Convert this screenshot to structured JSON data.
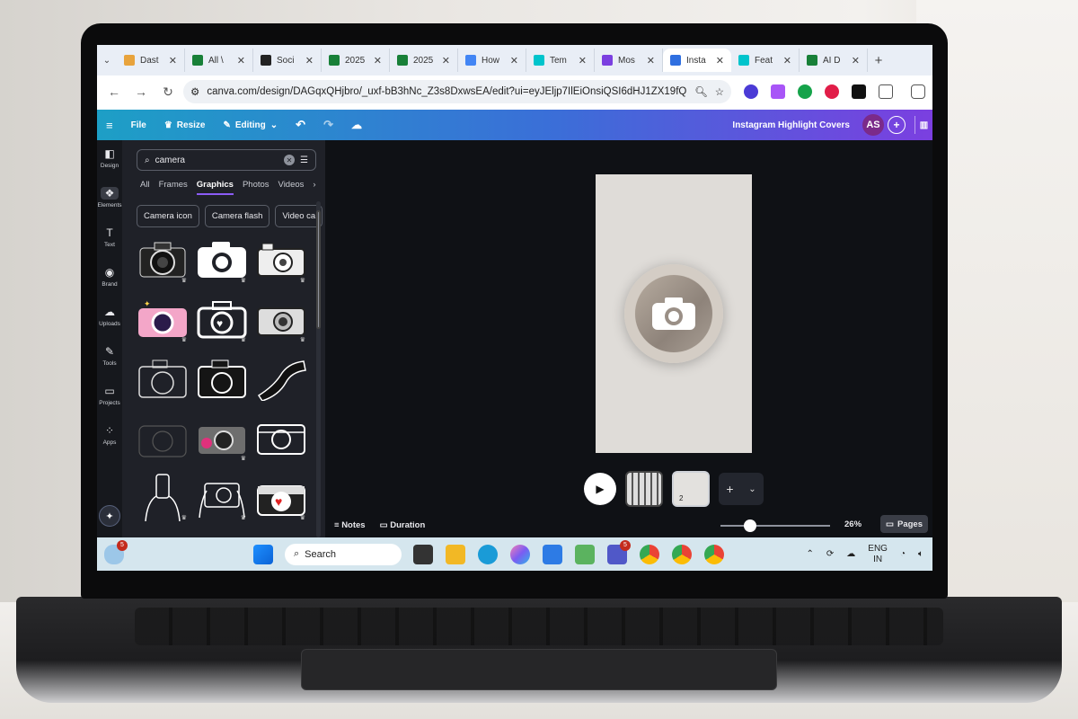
{
  "browser": {
    "tabs": [
      {
        "label": "Dast",
        "color": "#e8a33c"
      },
      {
        "label": "All \\",
        "color": "#188038"
      },
      {
        "label": "Soci",
        "color": "#222222"
      },
      {
        "label": "2025",
        "color": "#188038"
      },
      {
        "label": "2025",
        "color": "#188038"
      },
      {
        "label": "How",
        "color": "#4285f4"
      },
      {
        "label": "Tem",
        "color": "#00c4cc"
      },
      {
        "label": "Mos",
        "color": "#7b3fe0"
      },
      {
        "label": "Insta",
        "color": "#2f6fe0"
      },
      {
        "label": "Feat",
        "color": "#00c4cc"
      },
      {
        "label": "AI D",
        "color": "#188038"
      }
    ],
    "active_tab_index": 8,
    "url": "canva.com/design/DAGqxQHjbro/_uxf-bB3hNc_Z3s8DxwsEA/edit?ui=eyJEljp7IlEiOnsiQSI6dHJ1ZX19fQ"
  },
  "canva_toolbar": {
    "file_label": "File",
    "resize_label": "Resize",
    "editing_label": "Editing",
    "design_title": "Instagram Highlight Covers",
    "avatar_initials": "AS"
  },
  "rail": [
    {
      "label": "Design",
      "icon": "layout-icon"
    },
    {
      "label": "Elements",
      "icon": "shapes-icon"
    },
    {
      "label": "Text",
      "icon": "text-icon"
    },
    {
      "label": "Brand",
      "icon": "brand-icon"
    },
    {
      "label": "Uploads",
      "icon": "cloud-upload-icon"
    },
    {
      "label": "Tools",
      "icon": "pen-icon"
    },
    {
      "label": "Projects",
      "icon": "folder-icon"
    },
    {
      "label": "Apps",
      "icon": "apps-icon"
    }
  ],
  "panel": {
    "search_value": "camera",
    "categories": [
      "All",
      "Frames",
      "Graphics",
      "Photos",
      "Videos"
    ],
    "active_category": "Graphics",
    "chips": [
      "Camera icon",
      "Camera flash",
      "Video ca"
    ]
  },
  "canvas": {
    "pages": [
      "1",
      "2"
    ],
    "selected_page_count": "2"
  },
  "footer": {
    "notes_label": "Notes",
    "duration_label": "Duration",
    "zoom": "26%",
    "zoom_fraction": 0.26,
    "pages_label": "Pages"
  },
  "taskbar": {
    "search_placeholder": "Search",
    "weather_badge": "5",
    "teams_badge": "5",
    "language": "ENG",
    "region": "IN"
  }
}
